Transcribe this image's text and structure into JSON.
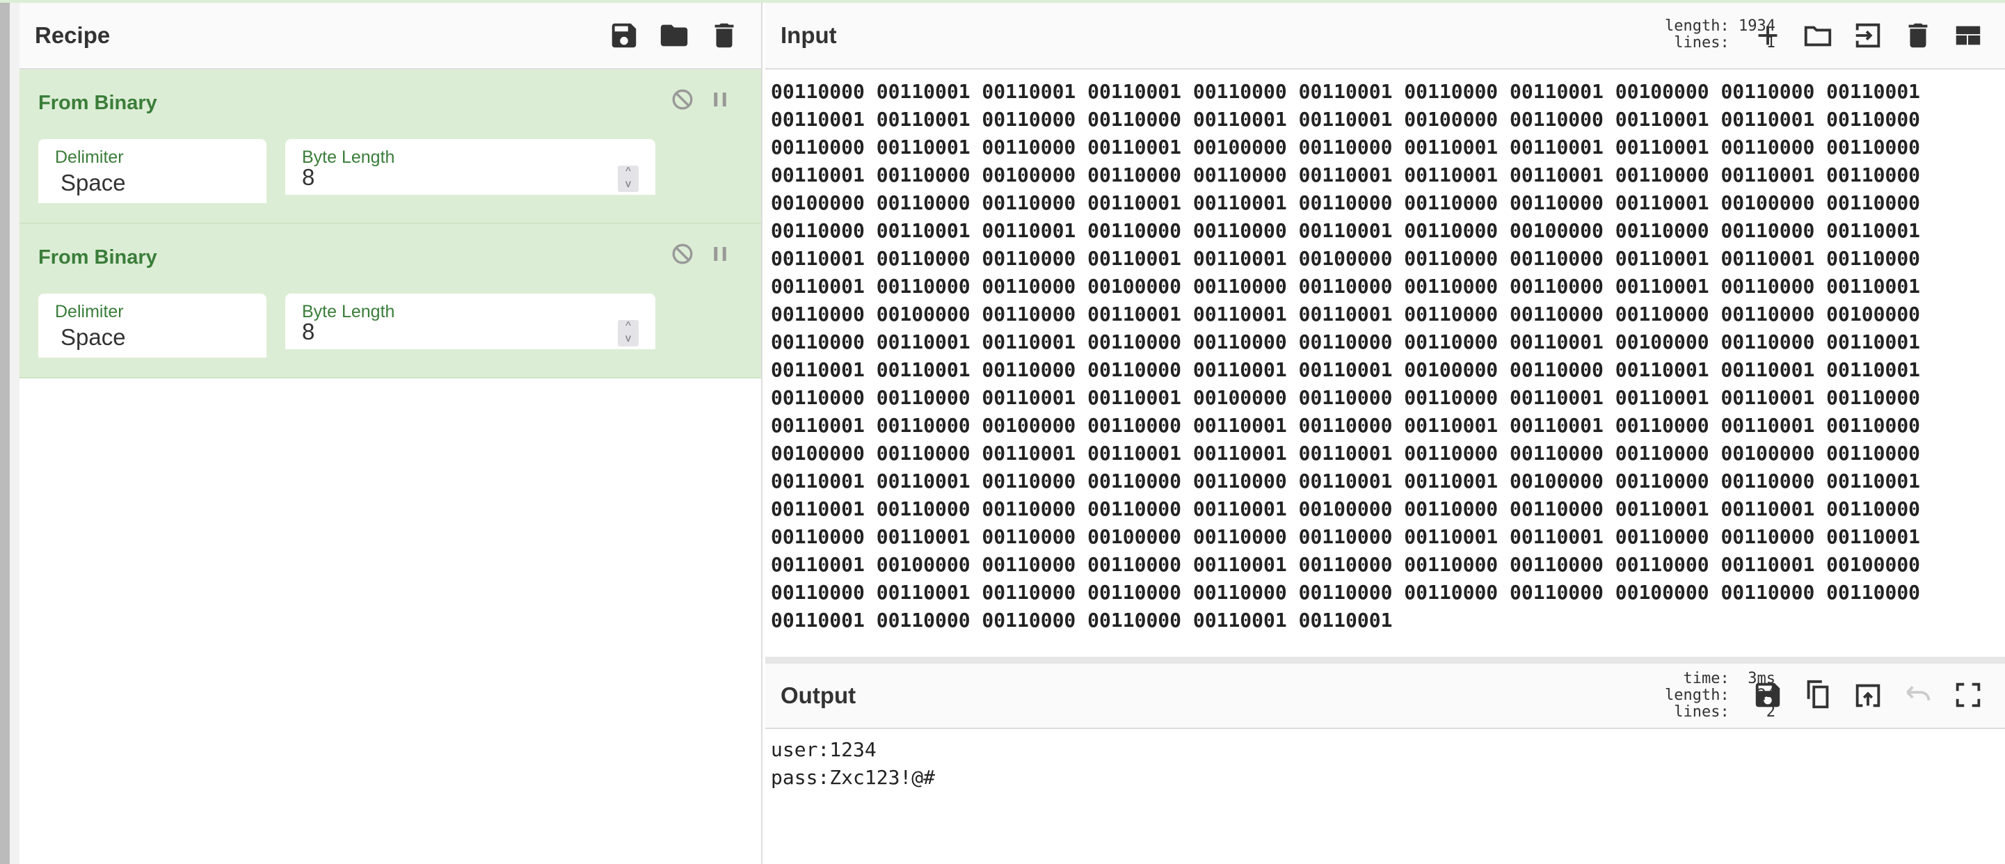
{
  "recipe": {
    "title": "Recipe",
    "icons": [
      "save-icon",
      "folder-icon",
      "trash-icon"
    ],
    "operations": [
      {
        "name": "From Binary",
        "delimiter_label": "Delimiter",
        "delimiter": "Space",
        "byte_length_label": "Byte Length",
        "byte_length": "8"
      },
      {
        "name": "From Binary",
        "delimiter_label": "Delimiter",
        "delimiter": "Space",
        "byte_length_label": "Byte Length",
        "byte_length": "8"
      }
    ]
  },
  "input": {
    "title": "Input",
    "stats": "length: 1934\n lines:    1",
    "icons": [
      "plus-icon",
      "folder-icon",
      "import-icon",
      "trash-icon",
      "layout-icon"
    ],
    "text": "00110000 00110001 00110001 00110001 00110000 00110001 00110000 00110001 00100000 00110000 00110001 00110001 00110001 00110000 00110000 00110001 00110001 00100000 00110000 00110001 00110001 00110000 00110000 00110001 00110000 00110001 00100000 00110000 00110001 00110001 00110001 00110000 00110000 00110001 00110000 00100000 00110000 00110000 00110001 00110001 00110001 00110000 00110001 00110000 00100000 00110000 00110000 00110001 00110001 00110000 00110000 00110000 00110001 00100000 00110000 00110000 00110001 00110001 00110000 00110000 00110001 00110000 00100000 00110000 00110000 00110001 00110001 00110000 00110000 00110001 00110001 00100000 00110000 00110000 00110001 00110001 00110000 00110001 00110000 00110000 00100000 00110000 00110000 00110000 00110000 00110001 00110000 00110001 00110000 00100000 00110000 00110001 00110001 00110001 00110000 00110000 00110000 00110000 00100000 00110000 00110001 00110001 00110000 00110000 00110000 00110000 00110001 00100000 00110000 00110001 00110001 00110001 00110000 00110000 00110001 00110001 00100000 00110000 00110001 00110001 00110001 00110000 00110000 00110001 00110001 00100000 00110000 00110000 00110001 00110001 00110001 00110000 00110001 00110000 00100000 00110000 00110001 00110000 00110001 00110001 00110000 00110001 00110000 00100000 00110000 00110001 00110001 00110001 00110001 00110000 00110000 00110000 00100000 00110000 00110001 00110001 00110000 00110000 00110000 00110001 00110001 00100000 00110000 00110000 00110001 00110001 00110000 00110000 00110000 00110001 00100000 00110000 00110000 00110001 00110001 00110000 00110000 00110001 00110000 00100000 00110000 00110000 00110001 00110001 00110000 00110000 00110001 00110001 00100000 00110000 00110000 00110001 00110000 00110000 00110000 00110000 00110001 00100000 00110000 00110001 00110000 00110000 00110000 00110000 00110000 00110000 00100000 00110000 00110000 00110001 00110000 00110000 00110000 00110001 00110001"
  },
  "output": {
    "title": "Output",
    "stats": "  time:  3ms\nlength:   24\n lines:    2",
    "icons": [
      "save-icon",
      "copy-icon",
      "replace-input-icon",
      "undo-icon",
      "maximize-icon"
    ],
    "text": "user:1234\npass:Zxc123!@#"
  },
  "colors": {
    "accent_green": "#3a7d3a",
    "op_background": "#dcedd5"
  }
}
